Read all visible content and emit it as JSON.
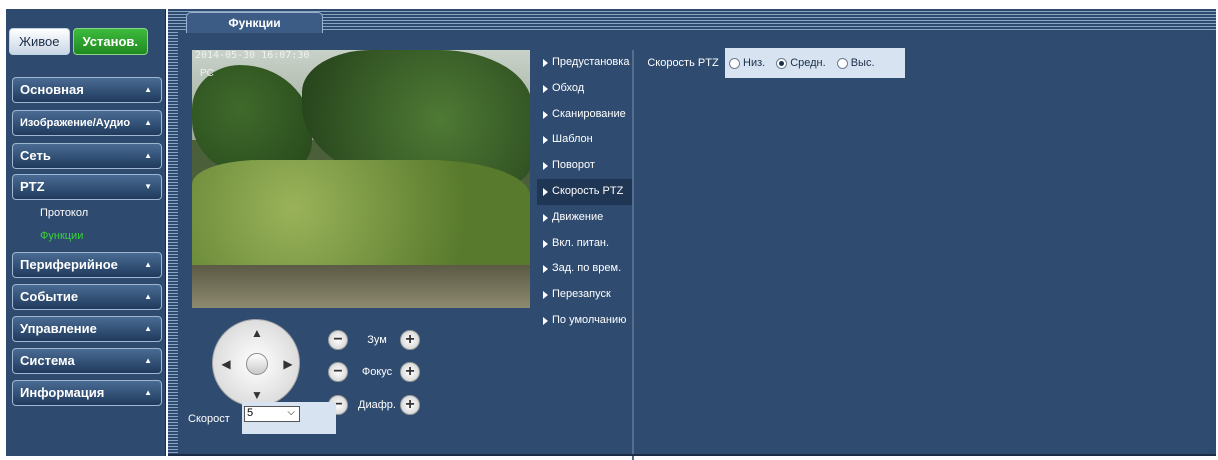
{
  "top_tabs": {
    "live_label": "Живое",
    "setup_label": "Установ."
  },
  "sidebar": {
    "menus": [
      {
        "label": "Основная",
        "arrow": "▲"
      },
      {
        "label": "Изображение/Аудио",
        "arrow": "▲"
      },
      {
        "label": "Сеть",
        "arrow": "▲"
      },
      {
        "label": "PTZ",
        "arrow": "▼"
      },
      {
        "label": "Периферийное",
        "arrow": "▲"
      },
      {
        "label": "Событие",
        "arrow": "▲"
      },
      {
        "label": "Управление",
        "arrow": "▲"
      },
      {
        "label": "Система",
        "arrow": "▲"
      },
      {
        "label": "Информация",
        "arrow": "▲"
      }
    ],
    "ptz_sub": [
      {
        "label": "Протокол"
      },
      {
        "label": "Функции"
      }
    ]
  },
  "main": {
    "tab_label": "Функции",
    "video": {
      "timestamp": "2014-05-30 16:07:30",
      "camera_label": "PC"
    },
    "controls": {
      "zoom_label": "Зум",
      "focus_label": "Фокус",
      "iris_label": "Диафр.",
      "minus": "−",
      "plus": "+",
      "speed_label": "Скорост",
      "speed_value": "5"
    },
    "function_menu": [
      {
        "label": "Предустановка"
      },
      {
        "label": "Обход"
      },
      {
        "label": "Сканирование"
      },
      {
        "label": "Шаблон"
      },
      {
        "label": "Поворот"
      },
      {
        "label": "Скорость PTZ"
      },
      {
        "label": "Движение"
      },
      {
        "label": "Вкл. питан."
      },
      {
        "label": "Зад. по врем."
      },
      {
        "label": "Перезапуск"
      },
      {
        "label": "По умолчанию"
      }
    ],
    "ptz_speed": {
      "label": "Скорость PTZ",
      "options": [
        {
          "label": "Низ."
        },
        {
          "label": "Средн."
        },
        {
          "label": "Выс."
        }
      ],
      "selected": "Средн."
    }
  }
}
